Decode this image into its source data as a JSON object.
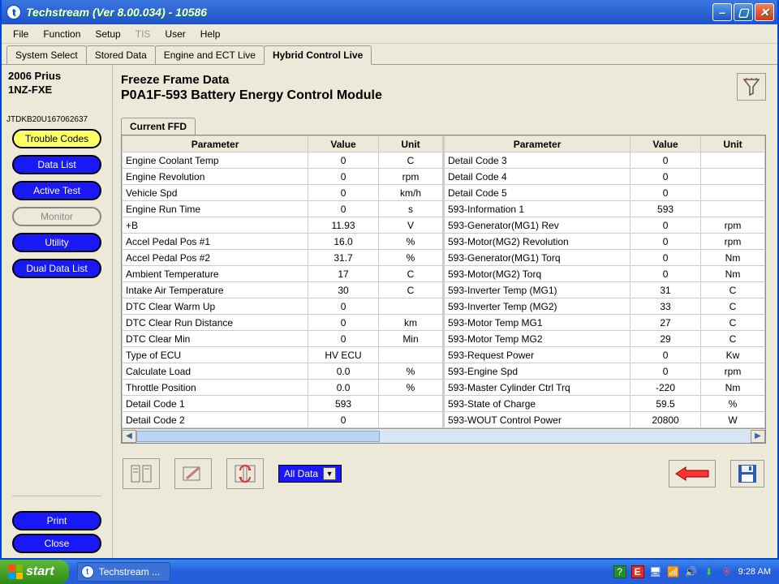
{
  "window": {
    "title": "Techstream (Ver 8.00.034) - 10586"
  },
  "menu": {
    "file": "File",
    "function": "Function",
    "setup": "Setup",
    "tis": "TIS",
    "user": "User",
    "help": "Help"
  },
  "top_tabs": [
    "System Select",
    "Stored Data",
    "Engine and ECT Live",
    "Hybrid Control Live"
  ],
  "active_top_tab": "Hybrid Control Live",
  "vehicle": {
    "model": "2006 Prius",
    "engine": "1NZ-FXE",
    "vin": "JTDKB20U167062637"
  },
  "sidebar": {
    "buttons": [
      {
        "label": "Trouble Codes",
        "style": "yellow"
      },
      {
        "label": "Data List",
        "style": "blue"
      },
      {
        "label": "Active Test",
        "style": "blue"
      },
      {
        "label": "Monitor",
        "style": "grey"
      },
      {
        "label": "Utility",
        "style": "blue"
      },
      {
        "label": "Dual Data List",
        "style": "blue"
      }
    ],
    "print": "Print",
    "close": "Close"
  },
  "main": {
    "heading": "Freeze Frame Data",
    "code": "P0A1F-593 Battery Energy Control Module",
    "subtab": "Current FFD",
    "headers": {
      "parameter": "Parameter",
      "value": "Value",
      "unit": "Unit"
    },
    "left": [
      {
        "p": "Engine Coolant Temp",
        "v": "0",
        "u": "C"
      },
      {
        "p": "Engine Revolution",
        "v": "0",
        "u": "rpm"
      },
      {
        "p": "Vehicle Spd",
        "v": "0",
        "u": "km/h"
      },
      {
        "p": "Engine Run Time",
        "v": "0",
        "u": "s"
      },
      {
        "p": "+B",
        "v": "11.93",
        "u": "V"
      },
      {
        "p": "Accel Pedal Pos #1",
        "v": "16.0",
        "u": "%"
      },
      {
        "p": "Accel Pedal Pos #2",
        "v": "31.7",
        "u": "%"
      },
      {
        "p": "Ambient Temperature",
        "v": "17",
        "u": "C"
      },
      {
        "p": "Intake Air Temperature",
        "v": "30",
        "u": "C"
      },
      {
        "p": "DTC Clear Warm Up",
        "v": "0",
        "u": ""
      },
      {
        "p": "DTC Clear Run Distance",
        "v": "0",
        "u": "km"
      },
      {
        "p": "DTC Clear Min",
        "v": "0",
        "u": "Min"
      },
      {
        "p": "Type of ECU",
        "v": "HV ECU",
        "u": ""
      },
      {
        "p": "Calculate Load",
        "v": "0.0",
        "u": "%"
      },
      {
        "p": "Throttle Position",
        "v": "0.0",
        "u": "%"
      },
      {
        "p": "Detail Code 1",
        "v": "593",
        "u": ""
      },
      {
        "p": "Detail Code 2",
        "v": "0",
        "u": ""
      }
    ],
    "right": [
      {
        "p": "Detail Code 3",
        "v": "0",
        "u": ""
      },
      {
        "p": "Detail Code 4",
        "v": "0",
        "u": ""
      },
      {
        "p": "Detail Code 5",
        "v": "0",
        "u": ""
      },
      {
        "p": "593-Information 1",
        "v": "593",
        "u": ""
      },
      {
        "p": "593-Generator(MG1) Rev",
        "v": "0",
        "u": "rpm"
      },
      {
        "p": "593-Motor(MG2) Revolution",
        "v": "0",
        "u": "rpm"
      },
      {
        "p": "593-Generator(MG1) Torq",
        "v": "0",
        "u": "Nm"
      },
      {
        "p": "593-Motor(MG2) Torq",
        "v": "0",
        "u": "Nm"
      },
      {
        "p": "593-Inverter Temp (MG1)",
        "v": "31",
        "u": "C"
      },
      {
        "p": "593-Inverter Temp (MG2)",
        "v": "33",
        "u": "C"
      },
      {
        "p": "593-Motor Temp MG1",
        "v": "27",
        "u": "C"
      },
      {
        "p": "593-Motor Temp MG2",
        "v": "29",
        "u": "C"
      },
      {
        "p": "593-Request Power",
        "v": "0",
        "u": "Kw"
      },
      {
        "p": "593-Engine Spd",
        "v": "0",
        "u": "rpm"
      },
      {
        "p": "593-Master Cylinder Ctrl Trq",
        "v": "-220",
        "u": "Nm"
      },
      {
        "p": "593-State of Charge",
        "v": "59.5",
        "u": "%"
      },
      {
        "p": "593-WOUT Control Power",
        "v": "20800",
        "u": "W"
      }
    ],
    "filter_label": "All Data"
  },
  "taskbar": {
    "start": "start",
    "app": "Techstream ...",
    "clock": "9:28 AM"
  }
}
